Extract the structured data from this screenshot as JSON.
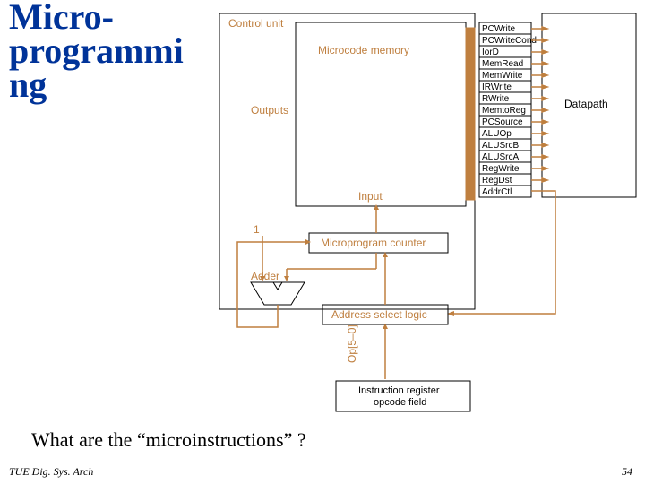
{
  "title": "Micro-programmi\nng",
  "question": "What are the “microinstructions” ?",
  "footer": {
    "left": "TUE Dig. Sys. Arch",
    "page": "54"
  },
  "diagram": {
    "control_unit": "Control unit",
    "microcode_memory": "Microcode memory",
    "outputs": "Outputs",
    "input": "Input",
    "datapath": "Datapath",
    "one": "1",
    "adder": "Adder",
    "microprogram_counter": "Microprogram counter",
    "address_select": "Address select logic",
    "op_field": "Op[5–0]",
    "ir_line1": "Instruction register",
    "ir_line2": "opcode field",
    "signals": [
      "PCWrite",
      "PCWriteCond",
      "IorD",
      "MemRead",
      "MemWrite",
      "IRWrite",
      "RWrite",
      "MemtoReg",
      "PCSource",
      "ALUOp",
      "ALUSrcB",
      "ALUSrcA",
      "RegWrite",
      "RegDst",
      "AddrCtl"
    ]
  }
}
